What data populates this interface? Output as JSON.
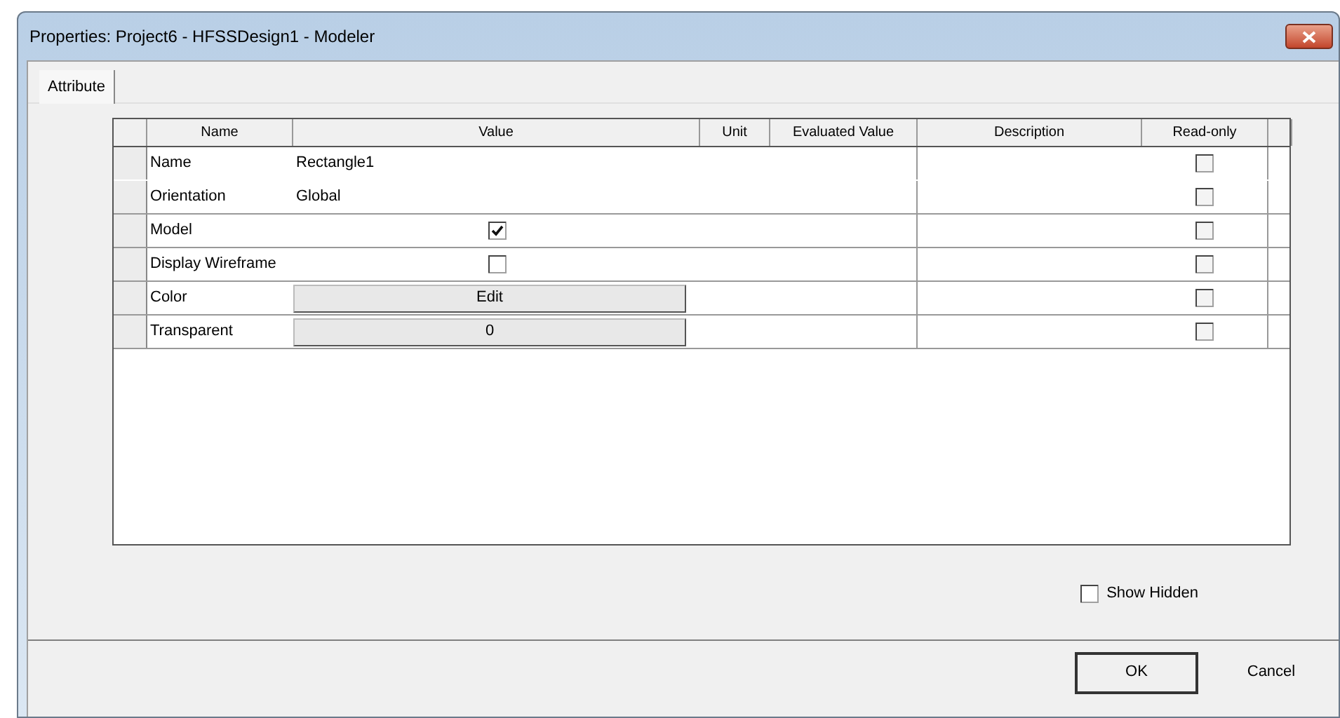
{
  "window": {
    "title": "Properties: Project6 - HFSSDesign1 - Modeler"
  },
  "tabs": [
    {
      "label": "Attribute",
      "selected": true
    }
  ],
  "table": {
    "columns": [
      "Name",
      "Value",
      "Unit",
      "Evaluated Value",
      "Description",
      "Read-only"
    ],
    "rows": [
      {
        "kind": "text",
        "name": "Name",
        "value": "Rectangle1",
        "read_only": false
      },
      {
        "kind": "text",
        "name": "Orientation",
        "value": "Global",
        "read_only": false
      },
      {
        "kind": "checkbox",
        "name": "Model",
        "checked": true,
        "read_only": false
      },
      {
        "kind": "checkbox",
        "name": "Display Wireframe",
        "checked": false,
        "read_only": false
      },
      {
        "kind": "button",
        "name": "Color",
        "value": "Edit",
        "read_only": false
      },
      {
        "kind": "button",
        "name": "Transparent",
        "value": "0",
        "read_only": false
      }
    ]
  },
  "show_hidden": {
    "label": "Show Hidden",
    "checked": false
  },
  "buttons": [
    {
      "label": "OK",
      "default": true
    },
    {
      "label": "Cancel",
      "default": false
    }
  ]
}
